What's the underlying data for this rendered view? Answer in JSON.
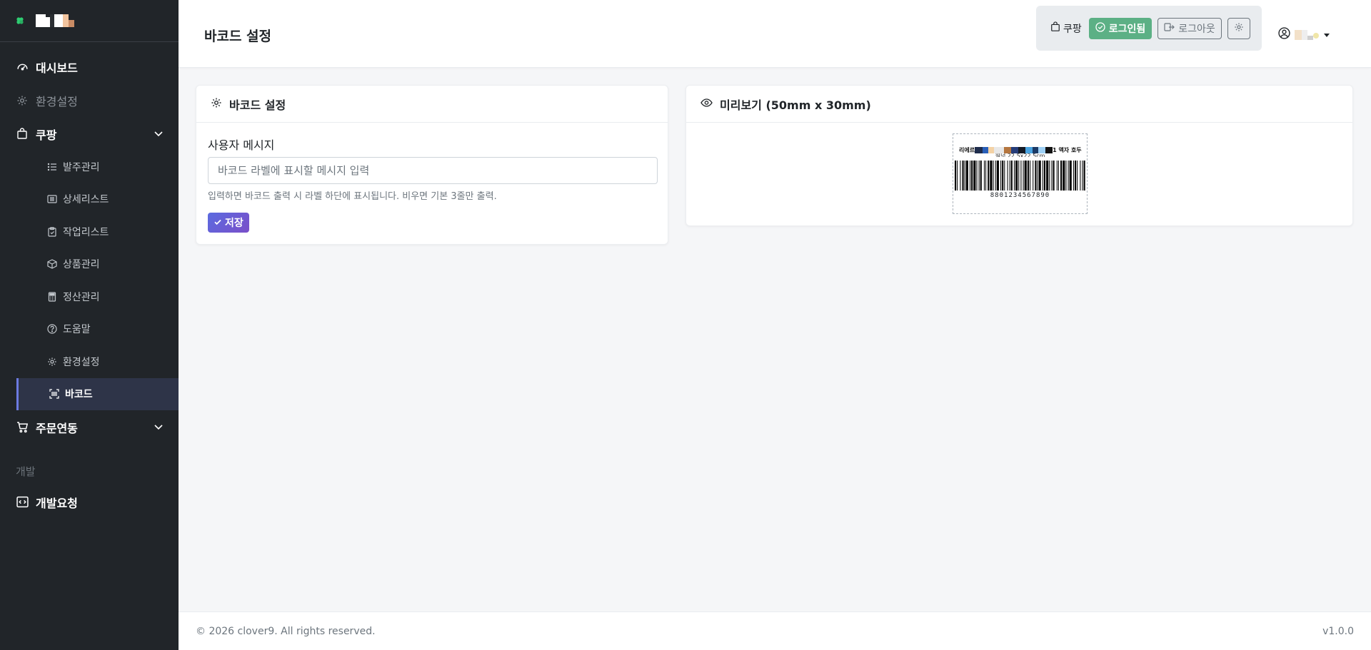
{
  "sidebar": {
    "logo_colors": [
      "#ffffff",
      "#ffffff",
      "#2b2f33",
      "#ffffff",
      "#f2c49e",
      "#c98b64"
    ],
    "items": [
      {
        "label": "대시보드",
        "icon": "speedometer-icon"
      },
      {
        "label": "환경설정",
        "icon": "gear-icon"
      },
      {
        "label": "쿠팡",
        "icon": "bag-icon"
      },
      {
        "label": "주문연동",
        "icon": "cart-icon"
      }
    ],
    "sub_items": [
      {
        "label": "발주관리",
        "icon": "list-icon"
      },
      {
        "label": "상세리스트",
        "icon": "card-list-icon"
      },
      {
        "label": "작업리스트",
        "icon": "clipboard-icon"
      },
      {
        "label": "상품관리",
        "icon": "box-icon"
      },
      {
        "label": "정산관리",
        "icon": "calculator-icon"
      },
      {
        "label": "도움말",
        "icon": "question-icon"
      },
      {
        "label": "환경설정",
        "icon": "gear-icon"
      },
      {
        "label": "바코드",
        "icon": "barcode-scan-icon"
      }
    ],
    "section_label": "개발",
    "dev_item": {
      "label": "개발요청",
      "icon": "code-icon"
    }
  },
  "header": {
    "title": "바코드 설정",
    "coupang_label": "쿠팡",
    "logged_in_label": "로그인됨",
    "logout_label": "로그아웃",
    "user_name_colors": [
      "#f3e1c9",
      "#eeeeee",
      "#cfcfcf",
      "#f0e6a8"
    ]
  },
  "settings_card": {
    "title": "바코드 설정",
    "field_label": "사용자 메시지",
    "input_value": "",
    "input_placeholder": "바코드 라벨에 표시할 메시지 입력",
    "hint": "입력하면 바코드 출력 시 라벨 하단에 표시됩니다. 비우면 기본 3줄만 출력.",
    "save_label": "저장"
  },
  "preview_card": {
    "title": "미리보기 (50mm x 30mm)",
    "label_prefix": "리에르",
    "label_suffix": "1 액자 호두",
    "label_line2": "월넛 22.5x22.5cm",
    "redaction_colors": [
      "#1f2d4d",
      "#2a5fb8",
      "#f4d2a5",
      "#e8e8e8",
      "#b5763f",
      "#263d7a",
      "#141a26",
      "#4aa3e0",
      "#1b3a66",
      "#9ed0f5",
      "#121212"
    ],
    "barcode_number": "8801234567890"
  },
  "footer": {
    "copyright": "© 2026 clover9. All rights reserved.",
    "version": "v1.0.0"
  }
}
